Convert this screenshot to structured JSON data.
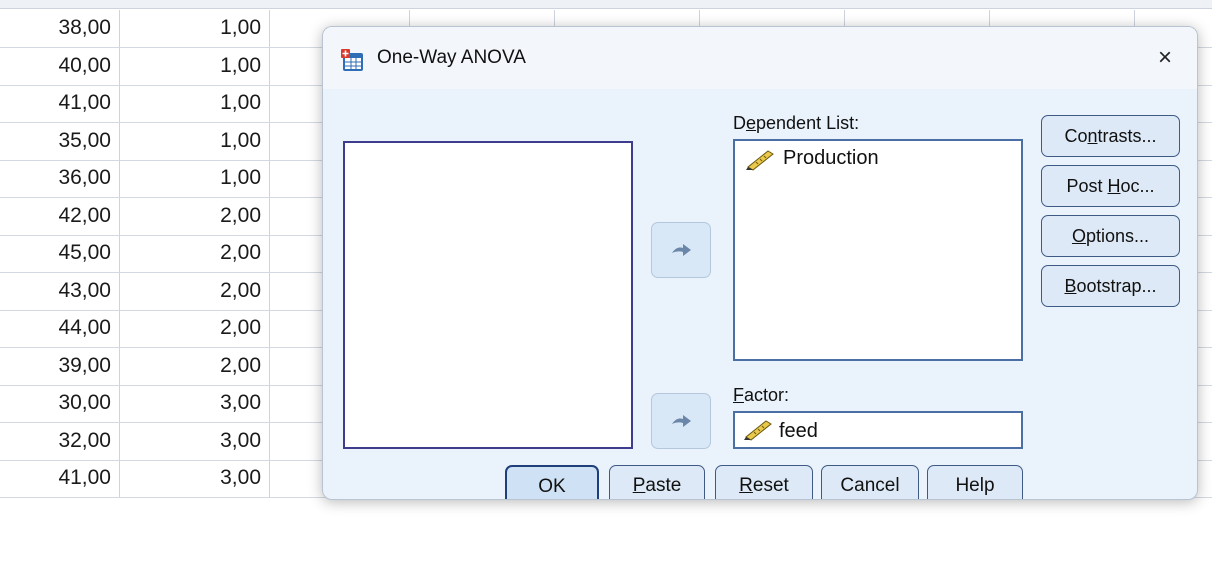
{
  "spreadsheet": {
    "rows": [
      [
        "38,00",
        "1,00"
      ],
      [
        "40,00",
        "1,00"
      ],
      [
        "41,00",
        "1,00"
      ],
      [
        "35,00",
        "1,00"
      ],
      [
        "36,00",
        "1,00"
      ],
      [
        "42,00",
        "2,00"
      ],
      [
        "45,00",
        "2,00"
      ],
      [
        "43,00",
        "2,00"
      ],
      [
        "44,00",
        "2,00"
      ],
      [
        "39,00",
        "2,00"
      ],
      [
        "30,00",
        "3,00"
      ],
      [
        "32,00",
        "3,00"
      ],
      [
        "41,00",
        "3,00"
      ]
    ]
  },
  "dialog": {
    "title": "One-Way ANOVA",
    "close_label": "×",
    "dependent_list": {
      "label_pre": "D",
      "label_u": "e",
      "label_post": "pendent List:",
      "items": [
        "Production"
      ]
    },
    "factor": {
      "label_u": "F",
      "label_post": "actor:",
      "value": "feed"
    },
    "side_buttons": {
      "contrasts": {
        "pre": "Co",
        "u": "n",
        "post": "trasts..."
      },
      "posthoc": {
        "pre": "Post ",
        "u": "H",
        "post": "oc..."
      },
      "options": {
        "pre": "",
        "u": "O",
        "post": "ptions..."
      },
      "bootstrap": {
        "pre": "",
        "u": "B",
        "post": "ootstrap..."
      }
    },
    "bottom_buttons": {
      "ok": {
        "pre": "OK",
        "u": "",
        "post": ""
      },
      "paste": {
        "pre": "",
        "u": "P",
        "post": "aste"
      },
      "reset": {
        "pre": "",
        "u": "R",
        "post": "eset"
      },
      "cancel": {
        "pre": "Cancel",
        "u": "",
        "post": ""
      },
      "help": {
        "pre": "Help",
        "u": "",
        "post": ""
      }
    },
    "icons": {
      "app": "spss-dialog-icon",
      "scale_variable": "ruler-pencil-icon",
      "move_arrow": "right-arrow-icon"
    }
  }
}
